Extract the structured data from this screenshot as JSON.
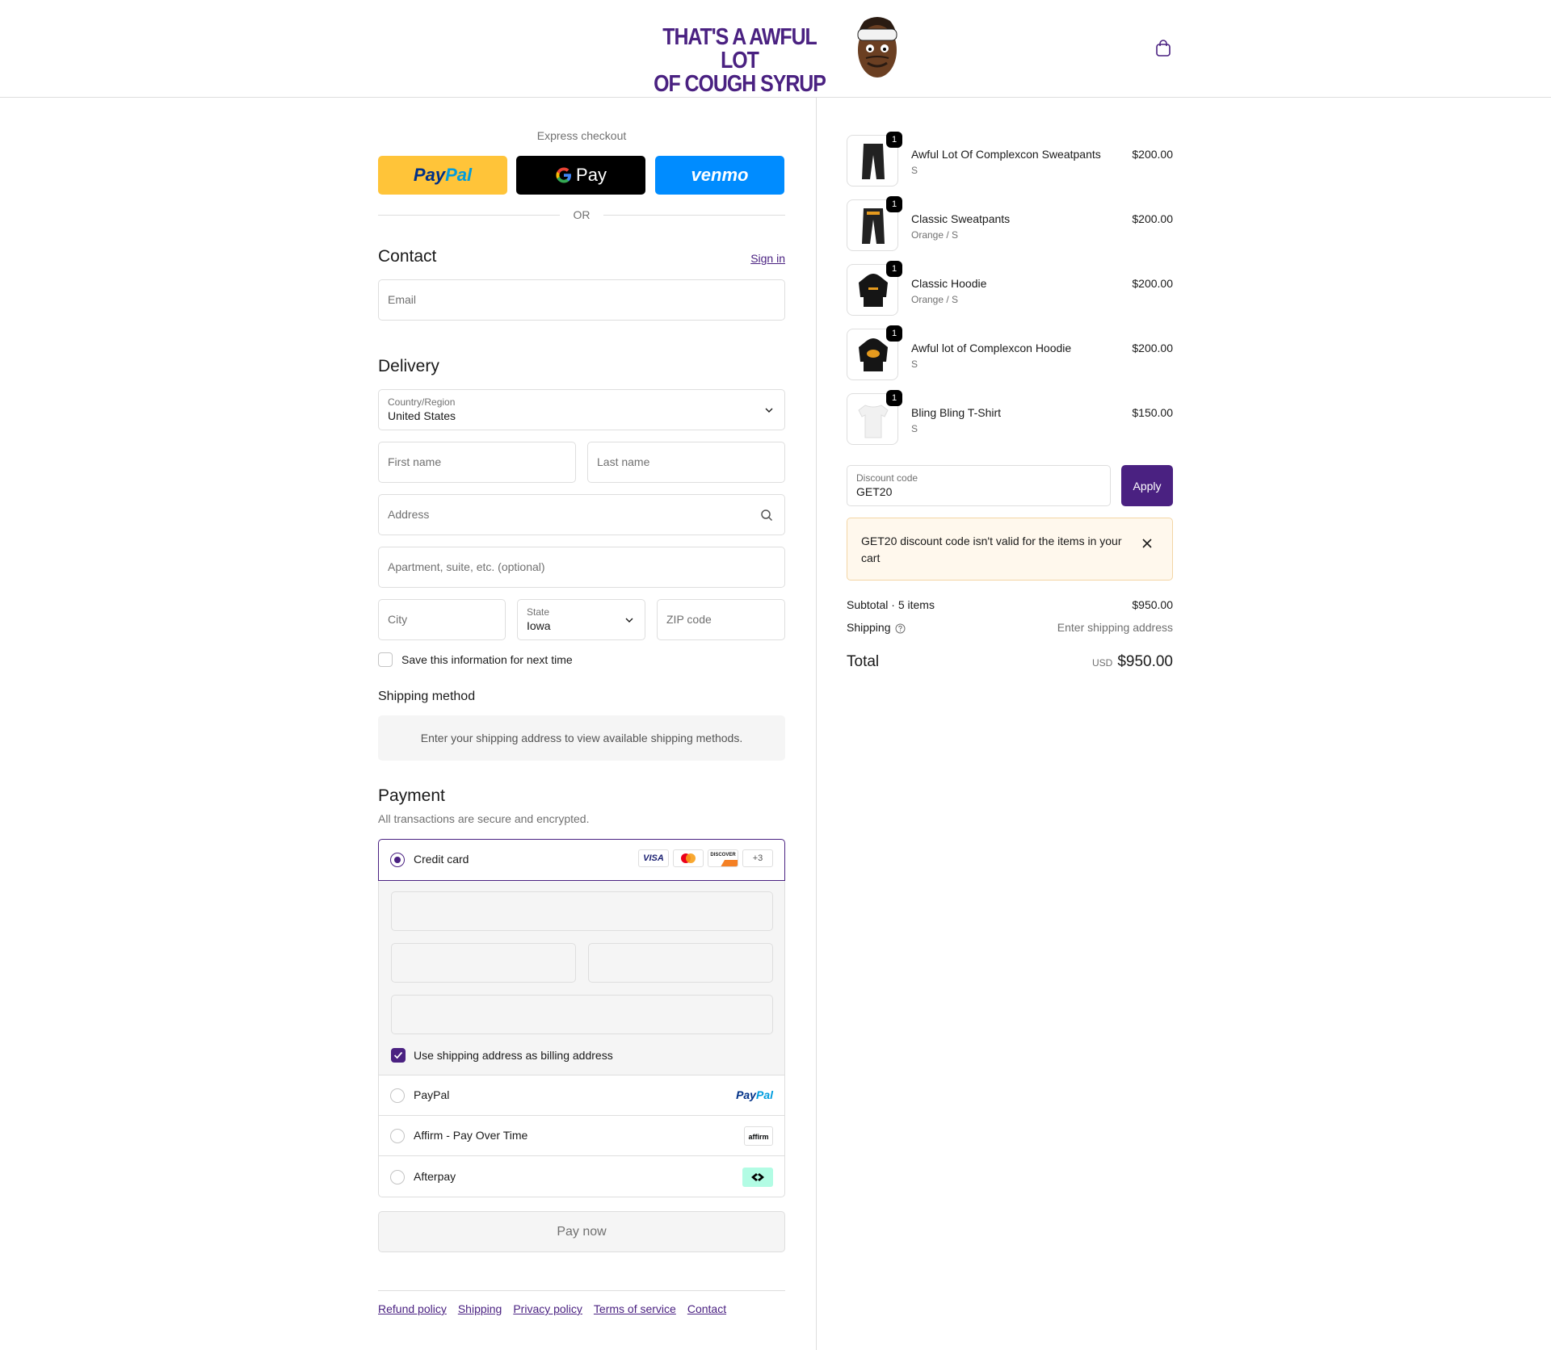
{
  "brand": {
    "logo_line1": "THAT'S A AWFUL LOT",
    "logo_line2": "OF COUGH SYRUP",
    "accent_color": "#4a2181"
  },
  "express": {
    "title": "Express checkout",
    "paypal_label_a": "Pay",
    "paypal_label_b": "Pal",
    "gpay_label": "Pay",
    "venmo_label": "venmo",
    "or": "OR"
  },
  "contact": {
    "heading": "Contact",
    "sign_in": "Sign in",
    "email_placeholder": "Email"
  },
  "delivery": {
    "heading": "Delivery",
    "country_label": "Country/Region",
    "country_value": "United States",
    "first_name_placeholder": "First name",
    "last_name_placeholder": "Last name",
    "address_placeholder": "Address",
    "apartment_placeholder": "Apartment, suite, etc. (optional)",
    "city_placeholder": "City",
    "state_label": "State",
    "state_value": "Iowa",
    "zip_placeholder": "ZIP code",
    "save_info": "Save this information for next time"
  },
  "shipping_method": {
    "heading": "Shipping method",
    "message": "Enter your shipping address to view available shipping methods."
  },
  "payment": {
    "heading": "Payment",
    "subtitle": "All transactions are secure and encrypted.",
    "credit_card": "Credit card",
    "card_badges": [
      "VISA",
      "DISCOVER",
      "+3"
    ],
    "use_shipping_as_billing": "Use shipping address as billing address",
    "paypal": "PayPal",
    "paypal_logo_a": "Pay",
    "paypal_logo_b": "Pal",
    "affirm": "Affirm - Pay Over Time",
    "affirm_logo": "affirm",
    "afterpay": "Afterpay",
    "pay_now": "Pay now"
  },
  "footer": {
    "links": [
      "Refund policy",
      "Shipping",
      "Privacy policy",
      "Terms of service",
      "Contact"
    ]
  },
  "cart": {
    "items": [
      {
        "qty": "1",
        "name": "Awful Lot Of Complexcon Sweatpants",
        "variant": "S",
        "price": "$200.00",
        "icon": "sweatpants-icon"
      },
      {
        "qty": "1",
        "name": "Classic Sweatpants",
        "variant": "Orange / S",
        "price": "$200.00",
        "icon": "sweatpants-icon"
      },
      {
        "qty": "1",
        "name": "Classic Hoodie",
        "variant": "Orange / S",
        "price": "$200.00",
        "icon": "hoodie-icon"
      },
      {
        "qty": "1",
        "name": "Awful lot of Complexcon Hoodie",
        "variant": "S",
        "price": "$200.00",
        "icon": "hoodie-icon"
      },
      {
        "qty": "1",
        "name": "Bling Bling T-Shirt",
        "variant": "S",
        "price": "$150.00",
        "icon": "tshirt-icon"
      }
    ],
    "discount_label": "Discount code",
    "discount_value": "GET20",
    "apply": "Apply",
    "error": "GET20 discount code isn't valid for the items in your cart",
    "subtotal_label": "Subtotal · 5 items",
    "subtotal_value": "$950.00",
    "shipping_label": "Shipping",
    "shipping_value": "Enter shipping address",
    "total_label": "Total",
    "total_currency": "USD",
    "total_value": "$950.00"
  }
}
